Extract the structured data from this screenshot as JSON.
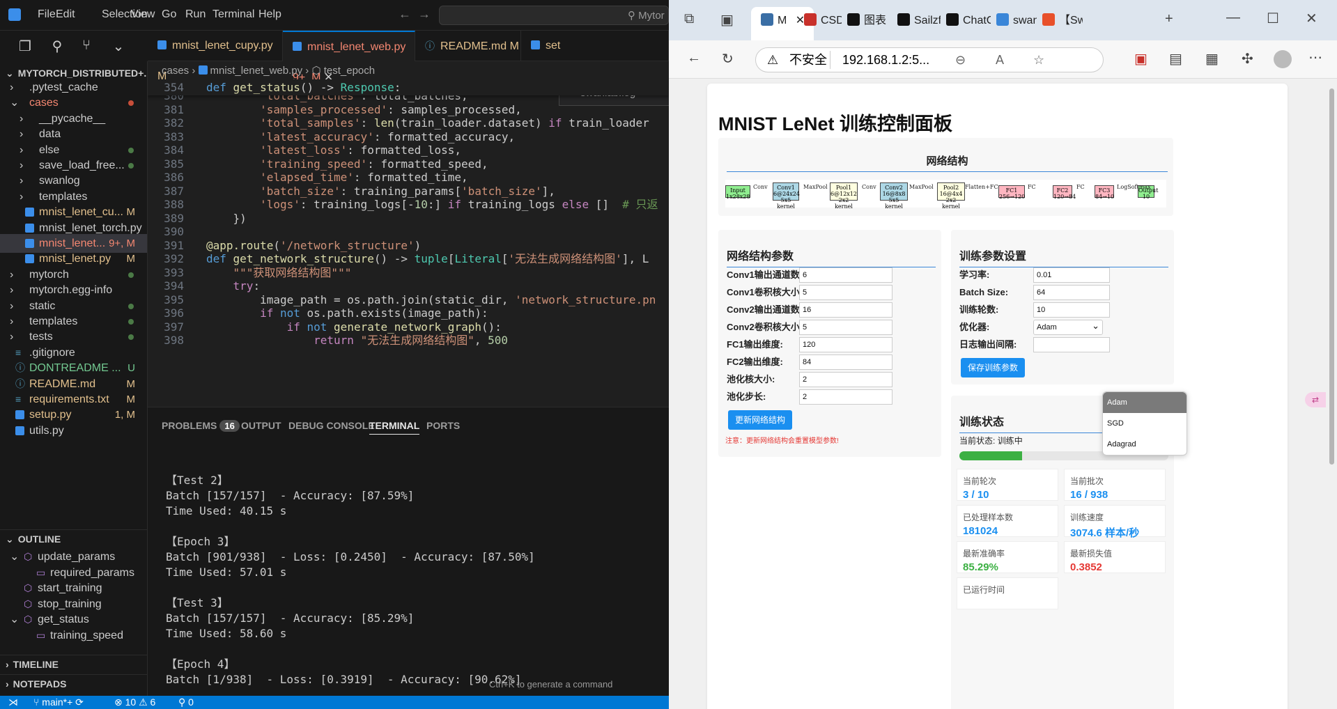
{
  "vscode": {
    "menu": [
      "File",
      "Edit",
      "Selection",
      "View",
      "Go",
      "Run",
      "Terminal",
      "Help"
    ],
    "command_center": "Mytor",
    "explorer_title": "MYTORCH_DISTRIBUTED+...",
    "tree": [
      {
        "label": ".pytest_cache",
        "indent": 0,
        "kind": "folder",
        "state": "collapsed"
      },
      {
        "label": "cases",
        "indent": 0,
        "kind": "folder",
        "state": "expanded",
        "badge": "",
        "dot": "red"
      },
      {
        "label": "__pycache__",
        "indent": 1,
        "kind": "folder",
        "state": "collapsed"
      },
      {
        "label": "data",
        "indent": 1,
        "kind": "folder",
        "state": "collapsed"
      },
      {
        "label": "else",
        "indent": 1,
        "kind": "folder",
        "state": "collapsed",
        "dot": "green"
      },
      {
        "label": "save_load_free...",
        "indent": 1,
        "kind": "folder",
        "state": "collapsed",
        "dot": "green"
      },
      {
        "label": "swanlog",
        "indent": 1,
        "kind": "folder",
        "state": "collapsed"
      },
      {
        "label": "templates",
        "indent": 1,
        "kind": "folder",
        "state": "collapsed"
      },
      {
        "label": "mnist_lenet_cu...",
        "indent": 1,
        "kind": "py",
        "badge": "M"
      },
      {
        "label": "mnist_lenet_torch.py",
        "indent": 1,
        "kind": "py"
      },
      {
        "label": "mnist_lenet...",
        "indent": 1,
        "kind": "py",
        "badge": "9+, M",
        "selected": true
      },
      {
        "label": "mnist_lenet.py",
        "indent": 1,
        "kind": "py",
        "badge": "M"
      },
      {
        "label": "mytorch",
        "indent": 0,
        "kind": "folder",
        "state": "collapsed",
        "dot": "green"
      },
      {
        "label": "mytorch.egg-info",
        "indent": 0,
        "kind": "folder",
        "state": "collapsed"
      },
      {
        "label": "static",
        "indent": 0,
        "kind": "folder",
        "state": "collapsed",
        "dot": "green"
      },
      {
        "label": "templates",
        "indent": 0,
        "kind": "folder",
        "state": "collapsed",
        "dot": "green"
      },
      {
        "label": "tests",
        "indent": 0,
        "kind": "folder",
        "state": "collapsed",
        "dot": "green"
      },
      {
        "label": ".gitignore",
        "indent": 0,
        "kind": "file"
      },
      {
        "label": "DONTREADME ...",
        "indent": 0,
        "kind": "md",
        "badge": "U"
      },
      {
        "label": "README.md",
        "indent": 0,
        "kind": "md",
        "badge": "M"
      },
      {
        "label": "requirements.txt",
        "indent": 0,
        "kind": "txt",
        "badge": "M"
      },
      {
        "label": "setup.py",
        "indent": 0,
        "kind": "py",
        "badge": "1, M"
      },
      {
        "label": "utils.py",
        "indent": 0,
        "kind": "py"
      }
    ],
    "outline_title": "OUTLINE",
    "outline": [
      {
        "label": "update_params",
        "indent": 0,
        "state": "expanded"
      },
      {
        "label": "required_params",
        "indent": 1
      },
      {
        "label": "start_training",
        "indent": 0
      },
      {
        "label": "stop_training",
        "indent": 0
      },
      {
        "label": "get_status",
        "indent": 0,
        "state": "expanded"
      },
      {
        "label": "training_speed",
        "indent": 1
      }
    ],
    "timeline_title": "TIMELINE",
    "notepads_title": "NOTEPADS",
    "tabs": [
      {
        "label": "mnist_lenet_cupy.py",
        "badge": "M"
      },
      {
        "label": "mnist_lenet_web.py",
        "badge": "9+, M",
        "active": true
      },
      {
        "label": "README.md",
        "badge": "M"
      },
      {
        "label": "set"
      }
    ],
    "breadcrumb": [
      "cases",
      "mnist_lenet_web.py",
      "test_epoch"
    ],
    "find_widget": "swanlab.log",
    "code": [
      {
        "n": "354",
        "h": "<span class='k'>def</span> <span class='f'>get_status</span>() -> <span class='t'>Response</span>:"
      },
      {
        "n": "380",
        "h": "        <span class='s'>'total_batches'</span>: total_batches,"
      },
      {
        "n": "381",
        "h": "        <span class='s'>'samples_processed'</span>: samples_processed,"
      },
      {
        "n": "382",
        "h": "        <span class='s'>'total_samples'</span>: <span class='f'>len</span>(train_loader.dataset) <span class='kw'>if</span> train_loader"
      },
      {
        "n": "383",
        "h": "        <span class='s'>'latest_accuracy'</span>: formatted_accuracy,"
      },
      {
        "n": "384",
        "h": "        <span class='s'>'latest_loss'</span>: formatted_loss,"
      },
      {
        "n": "385",
        "h": "        <span class='s'>'training_speed'</span>: formatted_speed,"
      },
      {
        "n": "386",
        "h": "        <span class='s'>'elapsed_time'</span>: formatted_time,"
      },
      {
        "n": "387",
        "h": "        <span class='s'>'batch_size'</span>: training_params[<span class='s'>'batch_size'</span>],"
      },
      {
        "n": "388",
        "h": "        <span class='s'>'logs'</span>: training_logs[-<span class='n'>10</span>:] <span class='kw'>if</span> training_logs <span class='kw'>else</span> []  <span class='c'># 只返</span>"
      },
      {
        "n": "389",
        "h": "    })"
      },
      {
        "n": "390",
        "h": ""
      },
      {
        "n": "391",
        "h": "<span class='f'>@app.route</span>(<span class='s'>'/network_structure'</span>)"
      },
      {
        "n": "392",
        "h": "<span class='k'>def</span> <span class='f'>get_network_structure</span>() -> <span class='t'>tuple</span>[<span class='t'>Literal</span>[<span class='s'>'无法生成网络结构图'</span>], L"
      },
      {
        "n": "393",
        "h": "    <span class='s'>\"\"\"获取网络结构图\"\"\"</span>"
      },
      {
        "n": "394",
        "h": "    <span class='kw'>try</span>:"
      },
      {
        "n": "395",
        "h": "        image_path = os.path.join(static_dir, <span class='s'>'network_structure.pn</span>"
      },
      {
        "n": "396",
        "h": "        <span class='kw'>if</span> <span class='k'>not</span> os.path.exists(image_path):"
      },
      {
        "n": "397",
        "h": "            <span class='kw'>if</span> <span class='k'>not</span> <span class='f'>generate_network_graph</span>():"
      },
      {
        "n": "398",
        "h": "                <span class='kw'>return</span> <span class='s'>\"无法生成网络结构图\"</span>, <span class='n'>500</span>"
      }
    ],
    "panel_tabs": [
      {
        "label": "PROBLEMS",
        "badge": "16"
      },
      {
        "label": "OUTPUT"
      },
      {
        "label": "DEBUG CONSOLE"
      },
      {
        "label": "TERMINAL",
        "active": true
      },
      {
        "label": "PORTS"
      }
    ],
    "terminal": [
      "",
      "【Test 2】",
      "Batch [157/157]  - Accuracy: [87.59%]",
      "Time Used: 40.15 s",
      "",
      "【Epoch 3】",
      "Batch [901/938]  - Loss: [0.2450]  - Accuracy: [87.50%]",
      "Time Used: 57.01 s",
      "",
      "【Test 3】",
      "Batch [157/157]  - Accuracy: [85.29%]",
      "Time Used: 58.60 s",
      "",
      "【Epoch 4】",
      "Batch [1/938]  - Loss: [0.3919]  - Accuracy: [90.62%]"
    ],
    "terminal_hint": "Ctrl+K to generate a command",
    "status": {
      "branch": "main*+",
      "errors": "10",
      "warnings": "6",
      "ports": "0"
    }
  },
  "browser": {
    "tabs": [
      {
        "label": "M",
        "active": true,
        "color": "#3a6ea5"
      },
      {
        "label": "CSDN",
        "color": "#c8312b"
      },
      {
        "label": "图表",
        "color": "#111"
      },
      {
        "label": "Sailzf",
        "color": "#111"
      },
      {
        "label": "ChatC",
        "color": "#111"
      },
      {
        "label": "swan",
        "color": "#3a86d8"
      },
      {
        "label": "【Sw",
        "color": "#e8502a"
      }
    ],
    "insecure_label": "不安全",
    "url": "192.168.1.2:5...",
    "page": {
      "title": "MNIST LeNet 训练控制面板",
      "network_section_title": "网络结构",
      "nn_nodes": [
        {
          "l1": "Input",
          "l2": "1x28x28",
          "color": "#90ee90"
        },
        {
          "l1": "Conv1",
          "l2": "6@24x24",
          "l3": "5x5 kernel",
          "color": "#add8e6"
        },
        {
          "l1": "Pool1",
          "l2": "6@12x12",
          "l3": "2x2 kernel",
          "color": "#ffffe0"
        },
        {
          "l1": "Conv2",
          "l2": "16@8x8",
          "l3": "5x5 kernel",
          "color": "#add8e6"
        },
        {
          "l1": "Pool2",
          "l2": "16@4x4",
          "l3": "2x2 kernel",
          "color": "#ffffe0"
        },
        {
          "l1": "FC1",
          "l2": "256→120",
          "color": "#ffb6c1"
        },
        {
          "l1": "FC2",
          "l2": "120→84",
          "color": "#ffb6c1"
        },
        {
          "l1": "FC3",
          "l2": "84→10",
          "color": "#ffb6c1"
        },
        {
          "l1": "Output",
          "l2": "10",
          "color": "#90ee90"
        }
      ],
      "nn_edges": [
        "Conv",
        "MaxPool",
        "Conv",
        "MaxPool",
        "Flatten+FC",
        "FC",
        "FC",
        "LogSoftmax"
      ],
      "net_params_title": "网络结构参数",
      "net_params": [
        {
          "label": "Conv1输出通道数:",
          "value": "6"
        },
        {
          "label": "Conv1卷积核大小:",
          "value": "5"
        },
        {
          "label": "Conv2输出通道数:",
          "value": "16"
        },
        {
          "label": "Conv2卷积核大小:",
          "value": "5"
        },
        {
          "label": "FC1输出维度:",
          "value": "120"
        },
        {
          "label": "FC2输出维度:",
          "value": "84"
        },
        {
          "label": "池化核大小:",
          "value": "2"
        },
        {
          "label": "池化步长:",
          "value": "2"
        }
      ],
      "update_net_btn": "更新网络结构",
      "warning": "注意：更新网络结构会重置模型参数!",
      "train_params_title": "训练参数设置",
      "train_params": [
        {
          "label": "学习率:",
          "value": "0.01"
        },
        {
          "label": "Batch Size:",
          "value": "64"
        },
        {
          "label": "训练轮数:",
          "value": "10"
        },
        {
          "label": "优化器:",
          "value": "Adam",
          "select": true
        },
        {
          "label": "日志输出间隔:",
          "value": ""
        }
      ],
      "save_btn": "保存训练参数",
      "optimizer_options": [
        "Adam",
        "SGD",
        "Adagrad"
      ],
      "status_title": "训练状态",
      "current_status_label": "当前状态:",
      "current_status": "训练中",
      "progress": 0.3,
      "stats": [
        {
          "label": "当前轮次",
          "value": "3 / 10",
          "color": "#1a8ff0"
        },
        {
          "label": "当前批次",
          "value": "16 / 938",
          "color": "#1a8ff0"
        },
        {
          "label": "已处理样本数",
          "value": "181024",
          "color": "#1a8ff0"
        },
        {
          "label": "训练速度",
          "value": "3074.6 样本/秒",
          "color": "#1a8ff0"
        },
        {
          "label": "最新准确率",
          "value": "85.29%",
          "color": "#3cb043"
        },
        {
          "label": "最新损失值",
          "value": "0.3852",
          "color": "#e53935"
        },
        {
          "label": "已运行时间",
          "value": "",
          "color": "#1a8ff0"
        }
      ]
    }
  }
}
